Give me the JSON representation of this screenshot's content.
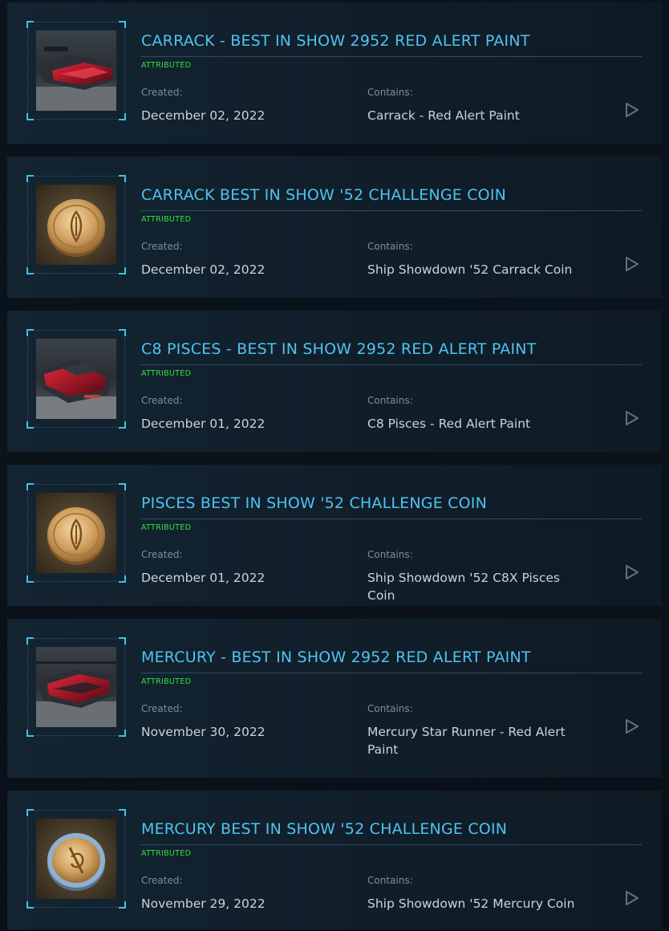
{
  "labels": {
    "created": "Created:",
    "contains": "Contains:"
  },
  "colors": {
    "title": "#4fc3f0",
    "status": "#32e23a",
    "accent_corner": "#39c6e0",
    "card_bg": "#101c27"
  },
  "items": [
    {
      "title": "CARRACK - BEST IN SHOW 2952 RED ALERT PAINT",
      "status": "ATTRIBUTED",
      "created": "December 02, 2022",
      "contains": "Carrack - Red Alert Paint",
      "thumbnail": "red-ship-thumbnail",
      "action_icon": "play-triangle-icon"
    },
    {
      "title": "CARRACK BEST IN SHOW '52 CHALLENGE COIN",
      "status": "ATTRIBUTED",
      "created": "December 02, 2022",
      "contains": "Ship Showdown '52 Carrack Coin",
      "thumbnail": "gold-coin-thumbnail",
      "action_icon": "play-triangle-icon"
    },
    {
      "title": "C8 PISCES - BEST IN SHOW 2952 RED ALERT PAINT",
      "status": "ATTRIBUTED",
      "created": "December 01, 2022",
      "contains": "C8 Pisces - Red Alert Paint",
      "thumbnail": "red-ship-thumbnail",
      "action_icon": "play-triangle-icon"
    },
    {
      "title": "PISCES BEST IN SHOW '52 CHALLENGE COIN",
      "status": "ATTRIBUTED",
      "created": "December 01, 2022",
      "contains": "Ship Showdown '52 C8X Pisces Coin",
      "thumbnail": "gold-coin-thumbnail",
      "action_icon": "play-triangle-icon"
    },
    {
      "title": "MERCURY - BEST IN SHOW 2952 RED ALERT PAINT",
      "status": "ATTRIBUTED",
      "created": "November 30, 2022",
      "contains": "Mercury Star Runner - Red Alert Paint",
      "thumbnail": "red-ship-thumbnail",
      "action_icon": "play-triangle-icon"
    },
    {
      "title": "MERCURY BEST IN SHOW '52 CHALLENGE COIN",
      "status": "ATTRIBUTED",
      "created": "November 29, 2022",
      "contains": "Ship Showdown '52 Mercury Coin",
      "thumbnail": "blue-rim-coin-thumbnail",
      "action_icon": "play-triangle-icon"
    }
  ]
}
